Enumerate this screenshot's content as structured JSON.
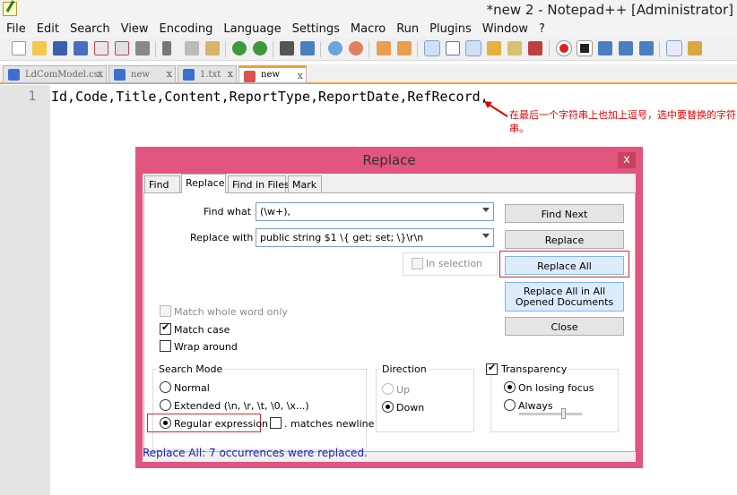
{
  "window": {
    "title": "*new  2 - Notepad++ [Administrator]"
  },
  "menu": [
    "File",
    "Edit",
    "Search",
    "View",
    "Encoding",
    "Language",
    "Settings",
    "Macro",
    "Run",
    "Plugins",
    "Window",
    "?"
  ],
  "tabs": [
    {
      "label": "LdComModel.cs",
      "close": "x"
    },
    {
      "label": "new",
      "close": "x"
    },
    {
      "label": "1.txt",
      "close": "x"
    },
    {
      "label": "new",
      "close": "x"
    }
  ],
  "editor": {
    "line_number": "1",
    "line_text": "Id,Code,Title,Content,ReportType,ReportDate,RefRecord,"
  },
  "annotation": {
    "note": "在最后一个字符串上也加上逗号，选中要替换的字符串。",
    "color": "#e00000"
  },
  "dialog": {
    "title": "Replace",
    "close": "x",
    "tabs": [
      "Find",
      "Replace",
      "Find in Files",
      "Mark"
    ],
    "find_what_label": "Find what :",
    "find_what_value": "(\\w+),",
    "replace_with_label": "Replace with :",
    "replace_with_value": "public string $1 \\{ get; set; \\}\\r\\n",
    "in_selection": "In selection",
    "buttons": {
      "find_next": "Find Next",
      "replace": "Replace",
      "replace_all": "Replace All",
      "replace_all_docs": "Replace All in All Opened Documents",
      "close": "Close"
    },
    "options": {
      "match_whole_word": "Match whole word only",
      "match_case": "Match case",
      "wrap_around": "Wrap around"
    },
    "search_mode": {
      "label": "Search Mode",
      "normal": "Normal",
      "extended": "Extended (\\n, \\r, \\t, \\0, \\x...)",
      "regex": "Regular expression",
      "matches_newline": ". matches newline"
    },
    "direction": {
      "label": "Direction",
      "up": "Up",
      "down": "Down"
    },
    "transparency": {
      "label": "Transparency",
      "on_losing_focus": "On losing focus",
      "always": "Always"
    },
    "status": "Replace All: 7 occurrences were replaced.",
    "accent_color": "#e1557e"
  }
}
